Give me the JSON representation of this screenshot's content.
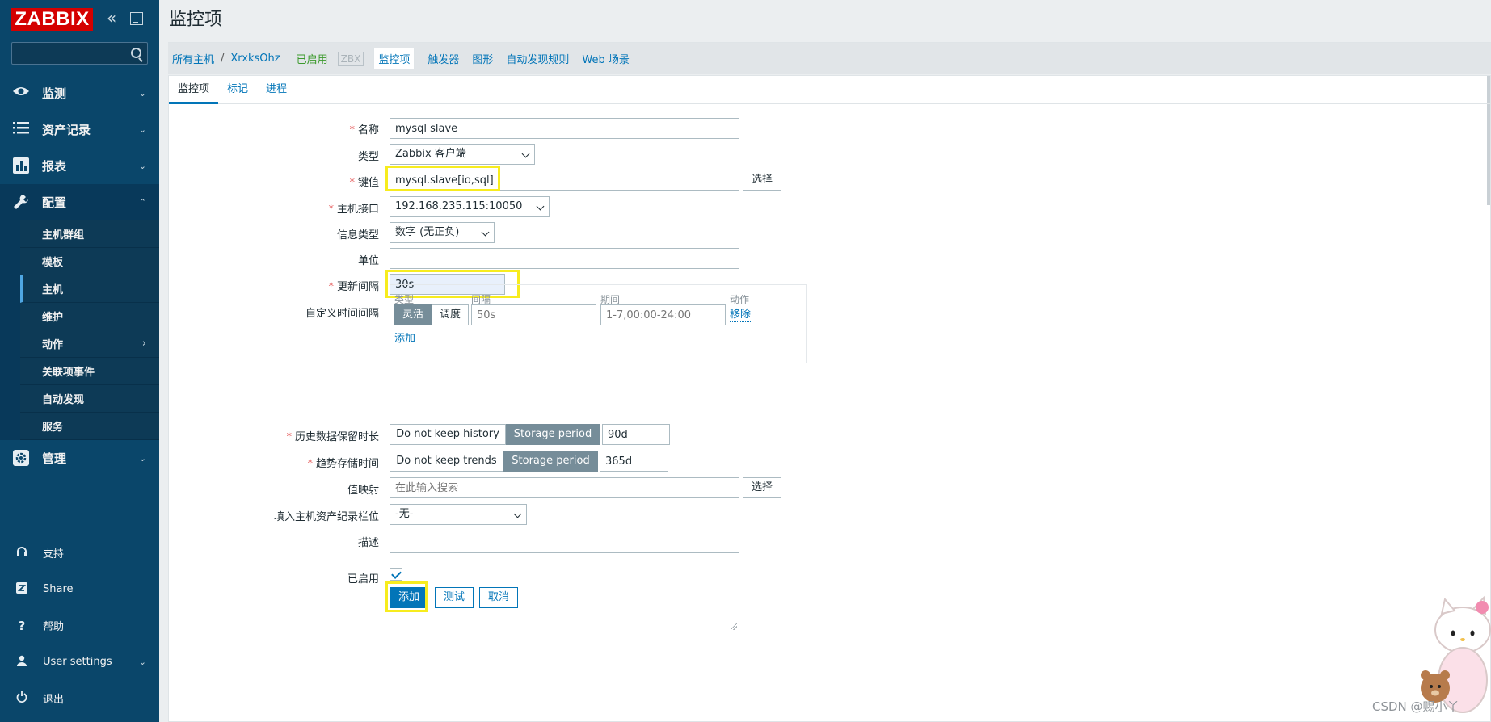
{
  "app": {
    "logo_text": "ZABBIX"
  },
  "sidebar": {
    "search_placeholder": "",
    "menu": [
      {
        "label": "监测",
        "icon": "eye-icon",
        "arrow": "⌄"
      },
      {
        "label": "资产记录",
        "icon": "list-icon",
        "arrow": "⌄"
      },
      {
        "label": "报表",
        "icon": "chart-icon",
        "arrow": "⌄"
      },
      {
        "label": "配置",
        "icon": "wrench-icon",
        "arrow": "⌃"
      }
    ],
    "submenu": [
      {
        "label": "主机群组"
      },
      {
        "label": "模板"
      },
      {
        "label": "主机"
      },
      {
        "label": "维护"
      },
      {
        "label": "动作",
        "arrow": "›"
      },
      {
        "label": "关联项事件"
      },
      {
        "label": "自动发现"
      },
      {
        "label": "服务"
      }
    ],
    "admin": {
      "label": "管理",
      "icon": "gear-icon",
      "arrow": "⌄"
    },
    "bottom": [
      {
        "label": "支持",
        "icon": "headset-icon"
      },
      {
        "label": "Share",
        "icon": "zabbix-share-icon"
      },
      {
        "label": "帮助",
        "icon": "help-icon"
      },
      {
        "label": "User settings",
        "icon": "user-icon",
        "arrow": "⌄"
      },
      {
        "label": "退出",
        "icon": "power-icon"
      }
    ]
  },
  "header": {
    "title": "监控项"
  },
  "host_nav": {
    "all_hosts": "所有主机",
    "separator": "/",
    "host_name": "XrxksOhz",
    "status": "已启用",
    "badge": "ZBX",
    "items": "监控项",
    "triggers": "触发器",
    "graphs": "图形",
    "discovery": "自动发现规则",
    "web": "Web 场景"
  },
  "tabs": [
    "监控项",
    "标记",
    "进程"
  ],
  "form": {
    "name": {
      "label": "名称",
      "value": "mysql slave"
    },
    "type": {
      "label": "类型",
      "value": "Zabbix 客户端"
    },
    "key": {
      "label": "键值",
      "value": "mysql.slave[io,sql]",
      "button": "选择"
    },
    "interface": {
      "label": "主机接口",
      "value": "192.168.235.115:10050"
    },
    "info_type": {
      "label": "信息类型",
      "value": "数字 (无正负)"
    },
    "units": {
      "label": "单位",
      "value": ""
    },
    "update_interval": {
      "label": "更新间隔",
      "value": "30s"
    },
    "custom_intervals": {
      "label": "自定义时间间隔",
      "headers": {
        "type": "类型",
        "interval": "间隔",
        "period": "期间",
        "action": "动作"
      },
      "flexible": "灵活",
      "scheduling": "调度",
      "interval_placeholder": "50s",
      "period_placeholder": "1-7,00:00-24:00",
      "remove": "移除",
      "add": "添加"
    },
    "history": {
      "label": "历史数据保留时长",
      "off": "Do not keep history",
      "on": "Storage period",
      "value": "90d"
    },
    "trends": {
      "label": "趋势存储时间",
      "off": "Do not keep trends",
      "on": "Storage period",
      "value": "365d"
    },
    "valuemap": {
      "label": "值映射",
      "placeholder": "在此输入搜索",
      "button": "选择"
    },
    "inventory": {
      "label": "填入主机资产纪录栏位",
      "value": "-无-"
    },
    "description": {
      "label": "描述",
      "value": ""
    },
    "enabled": {
      "label": "已启用"
    },
    "buttons": {
      "add": "添加",
      "test": "测试",
      "cancel": "取消"
    }
  },
  "watermark": "CSDN @赐小丫",
  "colors": {
    "sidebar": "#0a466a",
    "accent": "#0275b8",
    "logo": "#d40000",
    "highlight": "#f7ec1e",
    "enabled": "#3c9a2d",
    "required": "#e45959"
  }
}
